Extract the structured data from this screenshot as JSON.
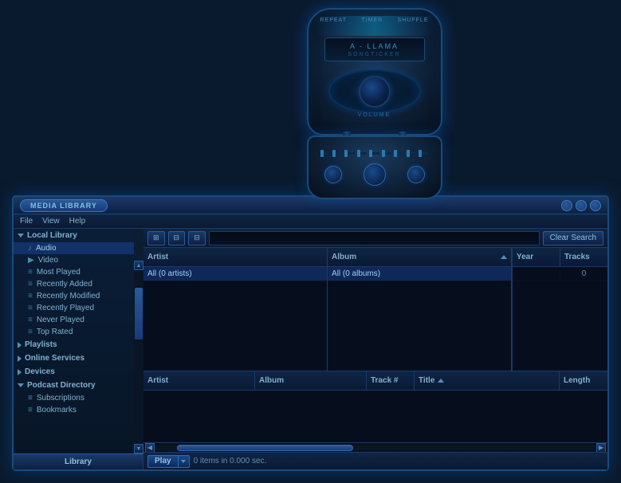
{
  "window": {
    "title": "MEDIA LIBRARY",
    "title_label": "MEDIA LIBRARY"
  },
  "menubar": {
    "items": [
      "File",
      "View",
      "Help"
    ]
  },
  "toolbar": {
    "clear_search_label": "Clear Search"
  },
  "browser": {
    "artist_col": "Artist",
    "album_col": "Album",
    "year_col": "Year",
    "tracks_col": "Tracks",
    "artist_row": "All (0 artists)",
    "album_row": "All (0 albums)",
    "tracks_count": "0"
  },
  "tracklist": {
    "col_artist": "Artist",
    "col_album": "Album",
    "col_tracknum": "Track #",
    "col_title": "Title",
    "col_length": "Length"
  },
  "sidebar": {
    "local_library_label": "Local Library",
    "audio_label": "Audio",
    "video_label": "Video",
    "most_played_label": "Most Played",
    "recently_added_label": "Recently Added",
    "recently_modified_label": "Recently Modified",
    "recently_played_label": "Recently Played",
    "never_played_label": "Never Played",
    "top_rated_label": "Top Rated",
    "playlists_label": "Playlists",
    "online_services_label": "Online Services",
    "devices_label": "Devices",
    "podcast_directory_label": "Podcast Directory",
    "subscriptions_label": "Subscriptions",
    "bookmarks_label": "Bookmarks",
    "library_tab_label": "Library"
  },
  "player": {
    "repeat_label": "REPEAT",
    "timer_label": "TIMER",
    "shuffle_label": "SHUFFLE",
    "app_name": "A - LLAMA",
    "songticker_label": "SONGTICKER",
    "volume_label": "VOLUME"
  },
  "bottom_bar": {
    "play_label": "Play",
    "status_text": "0 items in 0.000 sec."
  }
}
